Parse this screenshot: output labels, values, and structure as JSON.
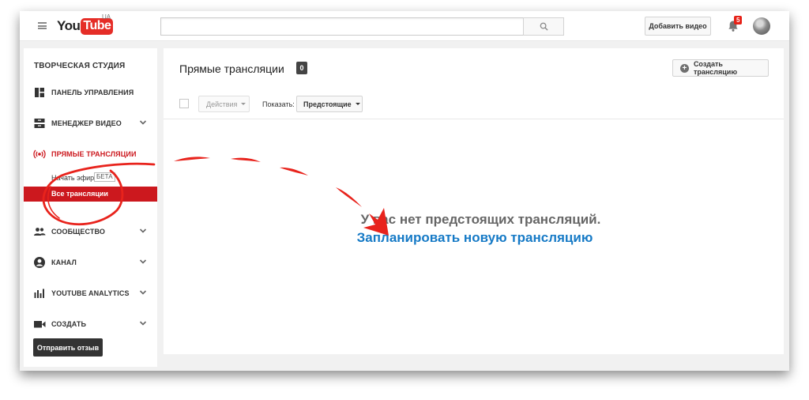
{
  "header": {
    "logo_you": "You",
    "logo_tube": "Tube",
    "region": "UA",
    "search_placeholder": "",
    "upload_label": "Добавить видео",
    "notifications_count": "5"
  },
  "sidebar": {
    "title": "ТВОРЧЕСКАЯ СТУДИЯ",
    "items": [
      {
        "label": "ПАНЕЛЬ УПРАВЛЕНИЯ",
        "icon": "dashboard-icon"
      },
      {
        "label": "МЕНЕДЖЕР ВИДЕО",
        "icon": "video-manager-icon"
      },
      {
        "label": "ПРЯМЫЕ ТРАНСЛЯЦИИ",
        "icon": "live-broadcast-icon"
      },
      {
        "label": "СООБЩЕСТВО",
        "icon": "community-icon"
      },
      {
        "label": "КАНАЛ",
        "icon": "channel-icon"
      },
      {
        "label": "YOUTUBE ANALYTICS",
        "icon": "analytics-icon"
      },
      {
        "label": "СОЗДАТЬ",
        "icon": "create-icon"
      }
    ],
    "live_sub": {
      "go_live": "Начать эфир",
      "beta": "БЕТА",
      "all_streams": "Все трансляции"
    },
    "feedback_label": "Отправить отзыв"
  },
  "main": {
    "title": "Прямые трансляции",
    "count": "0",
    "create_label": "Создать трансляцию",
    "actions_label": "Действия",
    "show_label": "Показать:",
    "show_value": "Предстоящие",
    "empty_text": "У вас нет предстоящих трансляций.",
    "schedule_link": "Запланировать новую трансляцию"
  },
  "colors": {
    "brand_red": "#e52d27",
    "active_red": "#cc181e",
    "link_blue": "#167ac6",
    "annotation_red": "#e8231c"
  }
}
